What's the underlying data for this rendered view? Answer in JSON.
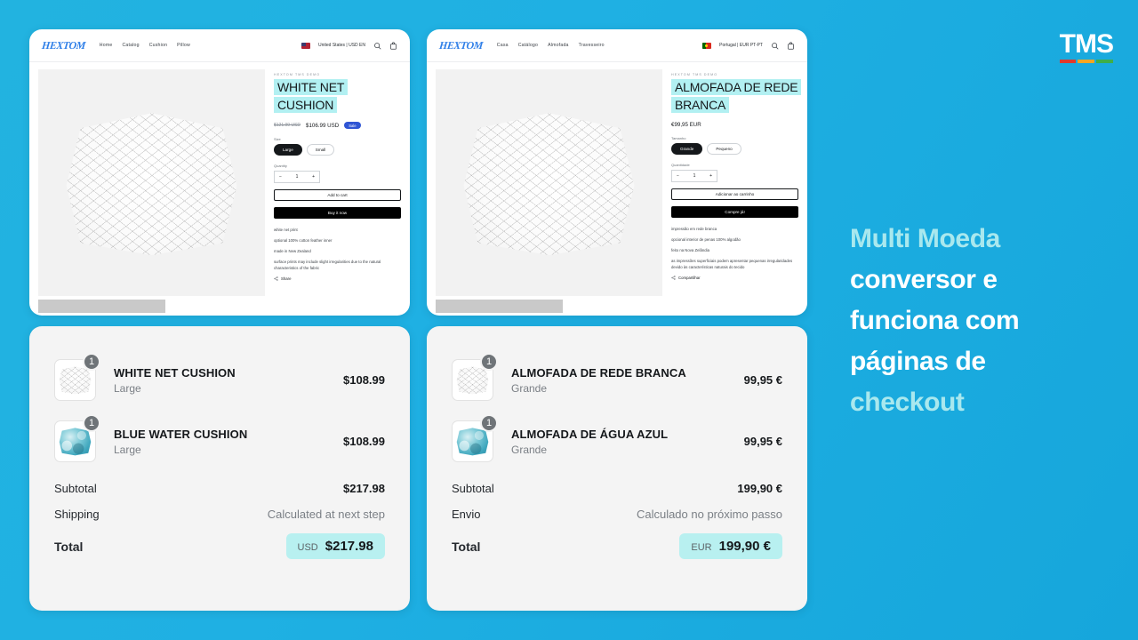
{
  "brand_logo": "TMS",
  "logo_bar_colors": [
    "#e0392b",
    "#f5a623",
    "#3fae49"
  ],
  "headline": {
    "line1": "Multi Moeda",
    "line2": "conversor e",
    "line3": "funciona com",
    "line4": "páginas de",
    "line5": "checkout",
    "accent_color": "#a9e8ee",
    "white_color": "#ffffff"
  },
  "shop_en": {
    "brand": "HEXTOM",
    "nav": [
      "Home",
      "Catalog",
      "Cushion",
      "Pillow"
    ],
    "locale": "United States | USD EN",
    "flag": "us-flag-icon",
    "search_icon": "search-icon",
    "cart_icon": "bag-icon",
    "vendor": "HEXTOM TMS DEMO",
    "title": "WHITE NET CUSHION",
    "price_old": "$121.99 USD",
    "price_new": "$106.99 USD",
    "sale_badge": "Sale",
    "size_label": "Size",
    "size_options": [
      "Large",
      "Small"
    ],
    "size_selected": "Large",
    "qty_label": "Quantity",
    "qty_minus": "−",
    "qty_value": "1",
    "qty_plus": "+",
    "add_to_cart": "Add to cart",
    "buy_now": "Buy it now",
    "desc": [
      "white net print",
      "optional 100% cotton feather inner",
      "made in New Zealand",
      "surface prints may include slight irregularities due to the natural characteristics of the fabric"
    ],
    "share": "Share"
  },
  "shop_pt": {
    "brand": "HEXTOM",
    "nav": [
      "Casa",
      "Catálogo",
      "Almofada",
      "Travesseiro"
    ],
    "locale": "Portugal | EUR PT-PT",
    "flag": "pt-flag-icon",
    "search_icon": "search-icon",
    "cart_icon": "bag-icon",
    "vendor": "HEXTOM TMS DEMO",
    "title": "ALMOFADA DE REDE BRANCA",
    "price_old": "",
    "price_new": "€99,95 EUR",
    "sale_badge": "",
    "size_label": "Tamanho",
    "size_options": [
      "Grande",
      "Pequeno"
    ],
    "size_selected": "Grande",
    "qty_label": "Quantidade",
    "qty_minus": "−",
    "qty_value": "1",
    "qty_plus": "+",
    "add_to_cart": "Adicionar ao carrinho",
    "buy_now": "Compre já!",
    "desc": [
      "impressão em rede branca",
      "opcional interior de penas 100% algodão",
      "feito na Nova Zelândia",
      "as impressões superficiais podem apresentar pequenas irregularidades devido às características naturais do tecido"
    ],
    "share": "Compartilhar"
  },
  "cart_en": {
    "items": [
      {
        "qty": "1",
        "title": "WHITE NET CUSHION",
        "variant": "Large",
        "price": "$108.99",
        "thumb": "white-net-cushion-thumb"
      },
      {
        "qty": "1",
        "title": "BLUE WATER CUSHION",
        "variant": "Large",
        "price": "$108.99",
        "thumb": "blue-water-cushion-thumb"
      }
    ],
    "subtotal_label": "Subtotal",
    "subtotal_value": "$217.98",
    "shipping_label": "Shipping",
    "shipping_value": "Calculated at next step",
    "total_label": "Total",
    "total_currency": "USD",
    "total_value": "$217.98"
  },
  "cart_pt": {
    "items": [
      {
        "qty": "1",
        "title": "ALMOFADA DE REDE BRANCA",
        "variant": "Grande",
        "price": "99,95 €",
        "thumb": "white-net-cushion-thumb"
      },
      {
        "qty": "1",
        "title": "ALMOFADA DE ÁGUA AZUL",
        "variant": "Grande",
        "price": "99,95 €",
        "thumb": "blue-water-cushion-thumb"
      }
    ],
    "subtotal_label": "Subtotal",
    "subtotal_value": "199,90 €",
    "shipping_label": "Envio",
    "shipping_value": "Calculado no próximo passo",
    "total_label": "Total",
    "total_currency": "EUR",
    "total_value": "199,90 €"
  }
}
